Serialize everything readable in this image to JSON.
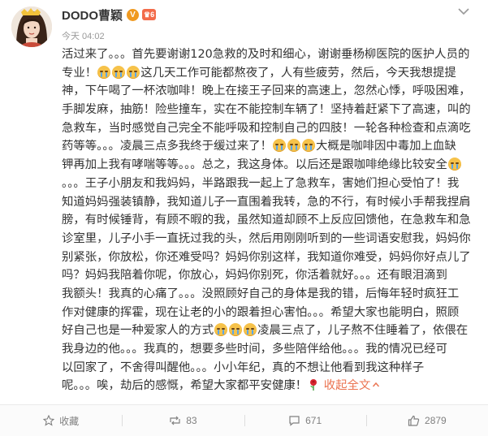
{
  "post": {
    "author": "DODO曹颖",
    "verified_badge": "V",
    "vip_badge": "6",
    "time": "今天 04:02",
    "lines": [
      [
        {
          "t": "活过来了。。。首先要谢谢120急救的及时和细心，谢谢垂杨柳医院的医护人员的"
        }
      ],
      [
        {
          "t": "专业！"
        },
        {
          "e": "cry"
        },
        {
          "e": "cry"
        },
        {
          "e": "cry"
        },
        {
          "t": "这几天工作可能都熬夜了，人有些疲劳，然后，今天我想提提"
        }
      ],
      [
        {
          "t": "神，下午喝了一杯浓咖啡！晚上在接王子回来的高速上，忽然心悸，呼吸困难，"
        }
      ],
      [
        {
          "t": "手脚发麻，抽筋！险些撞车，实在不能控制车辆了！坚持着赶紧下了高速，叫的"
        }
      ],
      [
        {
          "t": "急救车，当时感觉自己完全不能呼吸和控制自己的四肢！一轮各种检查和点滴吃"
        }
      ],
      [
        {
          "t": "药等等。。。凌晨三点多我终于缓过来了！"
        },
        {
          "e": "cry"
        },
        {
          "e": "cry"
        },
        {
          "e": "cry"
        },
        {
          "t": "大概是咖啡因中毒加上血缺"
        }
      ],
      [
        {
          "t": "钾再加上我有哮喘等等。。。总之，我这身体。以后还是跟咖啡绝缘比较安全"
        },
        {
          "e": "cry"
        }
      ],
      [
        {
          "t": "。。。王子小朋友和我妈妈，半路跟我一起上了急救车，害她们担心受怕了！我"
        }
      ],
      [
        {
          "t": "知道妈妈强装镇静，我知道儿子一直围着我转，急的不行，有时候小手帮我捏肩"
        }
      ],
      [
        {
          "t": "膀，有时候锤背，有顾不暇的我，虽然知道却顾不上反应回馈他，在急救车和急"
        }
      ],
      [
        {
          "t": "诊室里，儿子小手一直抚过我的头，然后用刚刚听到的一些词语安慰我，妈妈你"
        }
      ],
      [
        {
          "t": "别紧张，你放松，你还难受吗？妈妈你别这样，我知道你难受，妈妈你好点儿了"
        }
      ],
      [
        {
          "t": "吗？妈妈我陪着你呢，你放心，妈妈你别死，你活着就好。。。还有眼泪滴到"
        }
      ],
      [
        {
          "t": "我额头！我真的心痛了。。。没照顾好自己的身体是我的错，后悔年轻时疯狂工"
        }
      ],
      [
        {
          "t": "作对健康的挥霍，现在让老的小的跟着担心害怕。。。希望大家也能明白，照顾"
        }
      ],
      [
        {
          "t": "好自己也是一种爱家人的方式"
        },
        {
          "e": "cry"
        },
        {
          "e": "cry"
        },
        {
          "e": "cry"
        },
        {
          "t": "凌晨三点了，儿子熬不住睡着了，依偎在"
        }
      ],
      [
        {
          "t": "我身边的他。。。我真的，想要多些时间，多些陪伴给他。。。我的情况已经可"
        }
      ],
      [
        {
          "t": "以回家了，不舍得叫醒他。。。小小年纪，真的不想让他看到我这种样子"
        }
      ]
    ],
    "last_line": "呢。。。唉，劫后的感慨，希望大家都平安健康！",
    "collapse_label": "收起全文"
  },
  "footer": {
    "favorite_label": "收藏",
    "repost_count": "83",
    "comment_count": "671",
    "like_count": "2879"
  },
  "colors": {
    "accent": "#eb7350",
    "vip": "#f36b4a",
    "verified": "#f09a21"
  },
  "icons": [
    "more-chevron-icon",
    "cry-emoji-icon",
    "rose-icon",
    "star-icon",
    "repost-icon",
    "comment-icon",
    "like-icon"
  ]
}
